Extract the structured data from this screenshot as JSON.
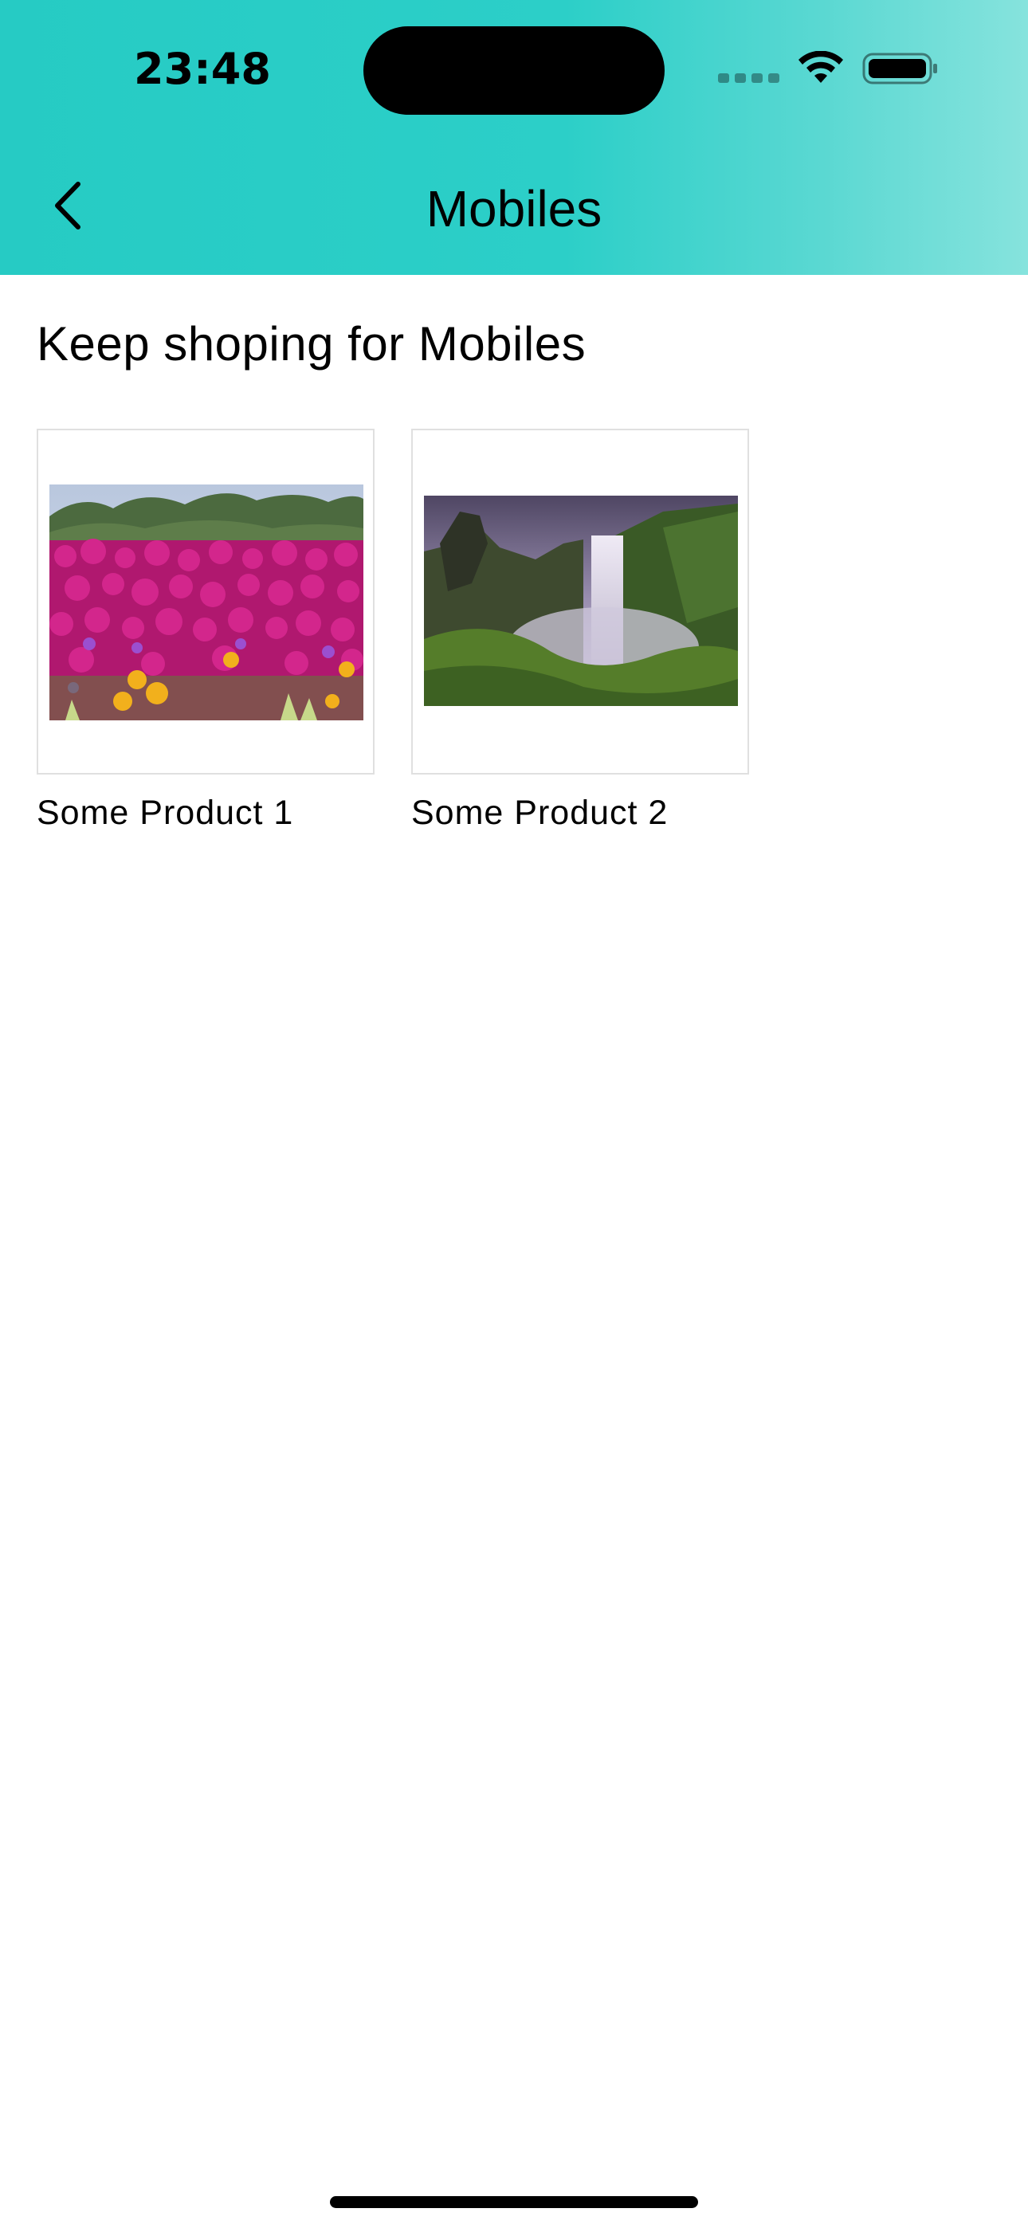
{
  "status_bar": {
    "time": "23:48",
    "icons": [
      "cellular-signal-icon",
      "wifi-icon",
      "battery-icon"
    ]
  },
  "app_bar": {
    "title": "Mobiles",
    "back_icon": "chevron-left-icon",
    "gradient_colors": [
      "#26cbc4",
      "#86e3dd"
    ]
  },
  "main": {
    "section_title": "Keep shoping for Mobiles",
    "products": [
      {
        "name": "Some Product 1",
        "image": "flower-field-photo"
      },
      {
        "name": "Some Product 2",
        "image": "waterfall-photo"
      }
    ]
  }
}
